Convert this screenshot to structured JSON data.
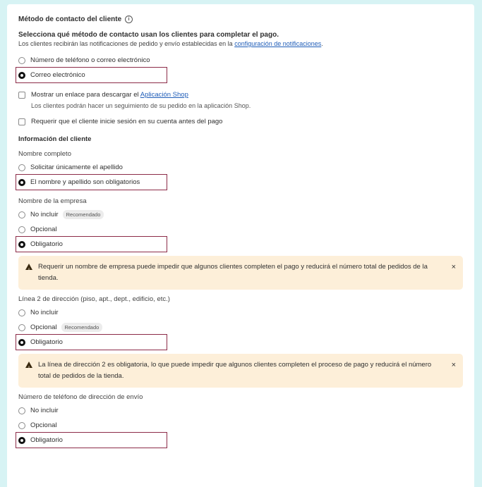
{
  "contact": {
    "title": "Método de contacto del cliente",
    "lead": "Selecciona qué método de contacto usan los clientes para completar el pago.",
    "sub_prefix": "Los clientes recibirán las notificaciones de pedido y envío establecidas en la ",
    "sub_link": "configuración de notificaciones",
    "sub_suffix": ".",
    "options": [
      "Número de teléfono o correo electrónico",
      "Correo electrónico"
    ]
  },
  "shop_app": {
    "label_prefix": "Mostrar un enlace para descargar el ",
    "label_link": "Aplicación Shop",
    "desc": "Los clientes podrán hacer un seguimiento de su pedido en la aplicación Shop."
  },
  "login": {
    "label": "Requerir que el cliente inicie sesión en su cuenta antes del pago"
  },
  "customer_info": {
    "heading": "Información del cliente",
    "full_name": {
      "label": "Nombre completo",
      "options": [
        "Solicitar únicamente el apellido",
        "El nombre y apellido son obligatorios"
      ]
    },
    "company": {
      "label": "Nombre de la empresa",
      "options": [
        "No incluir",
        "Opcional",
        "Obligatorio"
      ],
      "badge": "Recomendado",
      "warning": "Requerir un nombre de empresa puede impedir que algunos clientes completen el pago y reducirá el número total de pedidos de la tienda."
    },
    "address2": {
      "label": "Línea 2 de dirección (piso, apt., dept., edificio, etc.)",
      "options": [
        "No incluir",
        "Opcional",
        "Obligatorio"
      ],
      "badge": "Recomendado",
      "warning": "La línea de dirección 2 es obligatoria, lo que puede impedir que algunos clientes completen el proceso de pago y reducirá el número total de pedidos de la tienda."
    },
    "shipping_phone": {
      "label": "Número de teléfono de dirección de envío",
      "options": [
        "No incluir",
        "Opcional",
        "Obligatorio"
      ]
    }
  },
  "icons": {
    "close": "×",
    "info": "i",
    "warning": "!"
  }
}
